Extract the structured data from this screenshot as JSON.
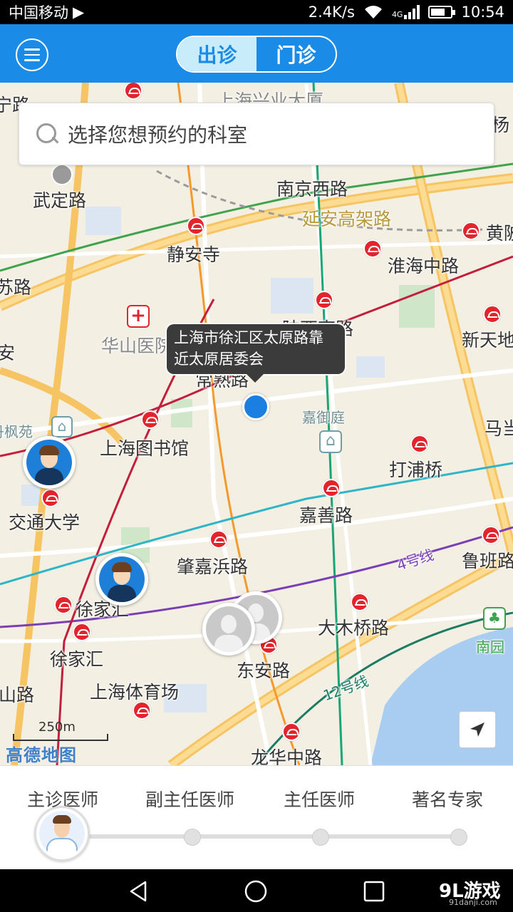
{
  "status_bar": {
    "carrier": "中国移动",
    "net_speed": "2.4K/s",
    "network_type": "4G",
    "time": "10:54"
  },
  "header": {
    "tab_active": "出诊",
    "tab_inactive": "门诊"
  },
  "search": {
    "placeholder": "选择您想预约的科室"
  },
  "map": {
    "labels": {
      "road_top_left": "宁路",
      "building_top": "上海兴业大厦",
      "wuding": "武定路",
      "nanjing_west": "南京西路",
      "yanan": "延安高架路",
      "jingan": "静安寺",
      "huangpi": "黄陂",
      "huaihai": "淮海中路",
      "left_road": "苏路",
      "huashan": "华山医院",
      "shaanxi": "陕西南路",
      "xintiandi": "新天地",
      "changshu": "常熟路",
      "left_an": "安",
      "jiayuting": "嘉御庭",
      "danfengyuan": "丹枫苑",
      "mada": "马当",
      "library": "上海图书馆",
      "dapuqiao": "打浦桥",
      "jiaotong": "交通大学",
      "jiashan": "嘉善路",
      "zhaojiabang": "肇嘉浜路",
      "lubanlu": "鲁班路",
      "xujiahui_1": "徐家汇",
      "line4": "4号线",
      "damuqiao": "大木桥路",
      "nanyuan": "南园",
      "xujiahui_2": "徐家汇",
      "dongan": "东安路",
      "shanlu": "山路",
      "stadium": "上海体育场",
      "line12": "12号线",
      "longhua": "龙华中路",
      "right_edge": "杨"
    },
    "tooltip_text": "上海市徐汇区太原路靠近太原居委会",
    "scale": "250m",
    "provider_logo": "高德地图"
  },
  "levels": [
    "主诊医师",
    "副主任医师",
    "主任医师",
    "著名专家"
  ],
  "watermark": {
    "brand": "9L游戏",
    "url": "91danji.com"
  },
  "colors": {
    "primary": "#1a8be6",
    "metro_red": "#e2242c",
    "location_blue": "#1a7fe0"
  }
}
